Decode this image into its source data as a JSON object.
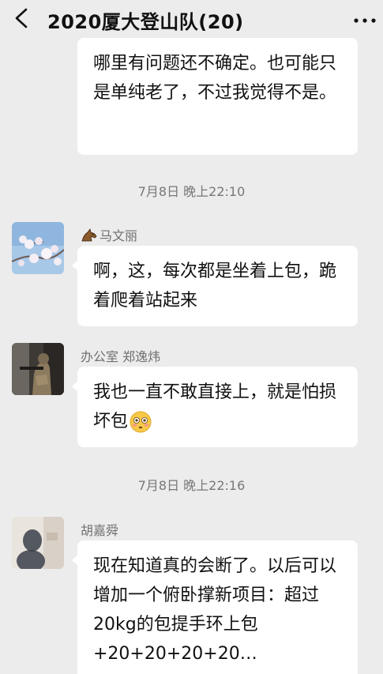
{
  "header": {
    "title": "2020厦大登山队(20)",
    "back_icon": "chevron-left-icon",
    "more_icon": "more-dots-icon"
  },
  "messages": [
    {
      "text": "哪里有问题还不确定。也可能只是单纯老了，不过我觉得不是。"
    },
    {
      "time": "7月8日 晚上22:10",
      "sender": "马文丽",
      "text": "啊，这，每次都是坐着上包，跪着爬着站起来"
    },
    {
      "sender": "办公室 郑逸炜",
      "text": "我也一直不敢直接上，就是怕损坏包",
      "emoji": "flushed-face-icon"
    },
    {
      "time": "7月8日 晚上22:16",
      "sender": "胡嘉舜",
      "text": "现在知道真的会断了。以后可以增加一个俯卧撑新项目：超过20kg的包提手环上包 +20+20+20+20…"
    }
  ],
  "colors": {
    "background": "#ececec",
    "bubble": "#ffffff",
    "meta_text": "#777777"
  }
}
